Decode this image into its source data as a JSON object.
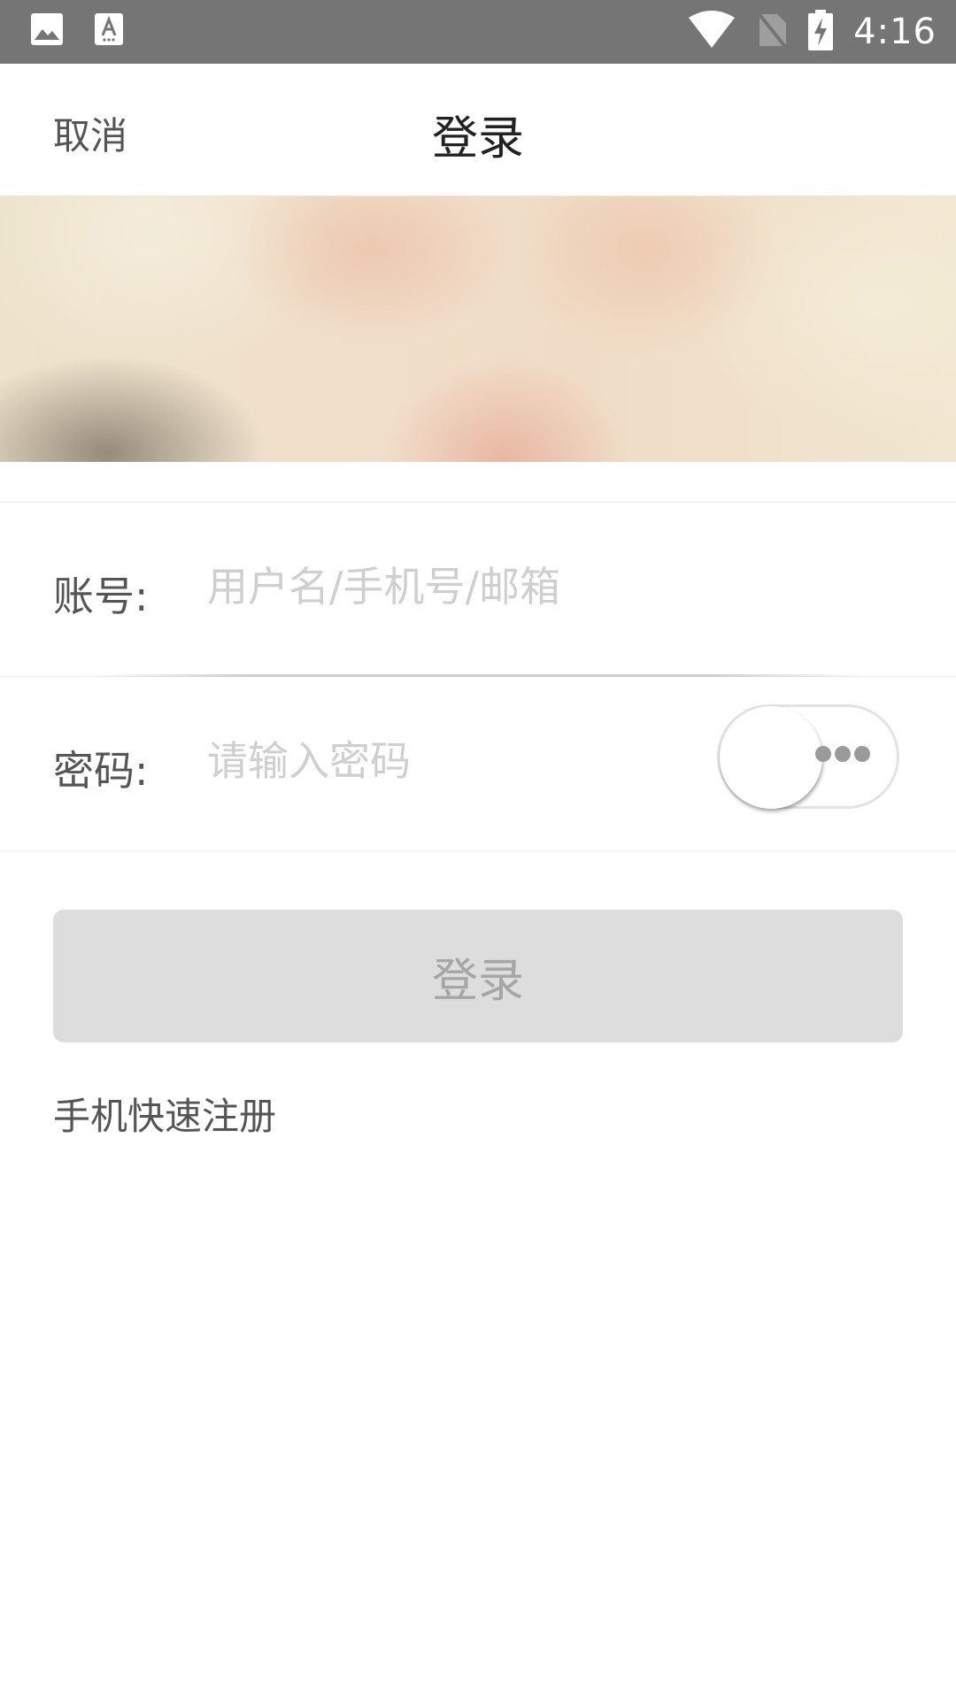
{
  "status_bar": {
    "time": "4:16",
    "left_icons": [
      "image-icon",
      "text-recognition-icon"
    ],
    "right_icons": [
      "wifi-icon",
      "no-sim-icon",
      "battery-charging-icon"
    ]
  },
  "nav": {
    "cancel_label": "取消",
    "title": "登录"
  },
  "form": {
    "account_label": "账号:",
    "account_placeholder": "用户名/手机号/邮箱",
    "account_value": "",
    "password_label": "密码:",
    "password_placeholder": "请输入密码",
    "password_value": "",
    "password_visibility_toggle": "off"
  },
  "actions": {
    "login_label": "登录",
    "register_label": "手机快速注册"
  },
  "colors": {
    "status_bar": "#757575",
    "button_disabled_bg": "#dddddd",
    "button_disabled_text": "#a6a6a6"
  }
}
